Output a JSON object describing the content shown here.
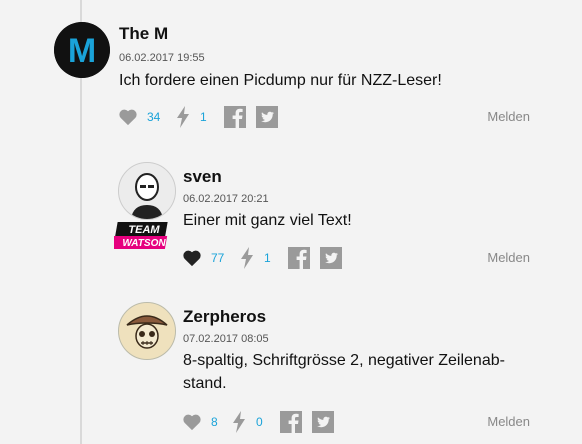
{
  "comments": [
    {
      "author": "The M",
      "date": "06.02.2017 19:55",
      "text": "Ich fordere einen Picdump nur für NZZ-Leser!",
      "likes": "34",
      "bolts": "1",
      "report": "Melden",
      "avatar_letter": "M",
      "avatar_icon": "m-logo-avatar"
    },
    {
      "author": "sven",
      "date": "06.02.2017 20:21",
      "text": "Einer mit ganz viel Text!",
      "likes": "77",
      "bolts": "1",
      "report": "Melden",
      "avatar_icon": "bald-man-avatar",
      "badge_line1": "TEAM",
      "badge_line2": "WATSON"
    },
    {
      "author": "Zerpheros",
      "date": "07.02.2017 08:05",
      "text_line1": "8-spaltig, Schriftgrösse 2, negativer Zeilenab-",
      "text_line2": "stand.",
      "likes": "8",
      "bolts": "0",
      "report": "Melden",
      "avatar_icon": "skull-mushroom-avatar"
    }
  ],
  "colors": {
    "background": "#f3f3f3",
    "accent": "#1aa3d9",
    "icon_gray": "#9a9a9a",
    "badge_pink": "#e6007e",
    "avatar_m_blue": "#1aa3d9"
  }
}
